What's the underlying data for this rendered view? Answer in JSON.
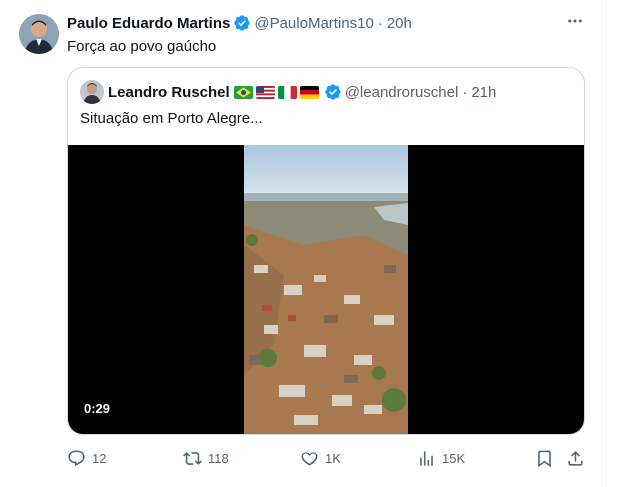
{
  "tweet": {
    "author_name": "Paulo Eduardo Martins",
    "author_handle": "@PauloMartins10",
    "separator": "·",
    "time": "20h",
    "text": "Força ao povo gaúcho",
    "more_icon": "more-horizontal-icon"
  },
  "quote": {
    "author_name": "Leandro Ruschel",
    "flags": [
      "brazil-flag",
      "usa-flag",
      "italy-flag",
      "germany-flag"
    ],
    "author_handle": "@leandroruschel",
    "separator": "·",
    "time": "21h",
    "text": "Situação em Porto Alegre...",
    "video_duration": "0:29"
  },
  "actions": {
    "replies": "12",
    "reposts": "118",
    "likes": "1K",
    "views": "15K"
  },
  "colors": {
    "verified": "#1d9bf0",
    "muted": "#536471",
    "border": "#cfd9de"
  }
}
